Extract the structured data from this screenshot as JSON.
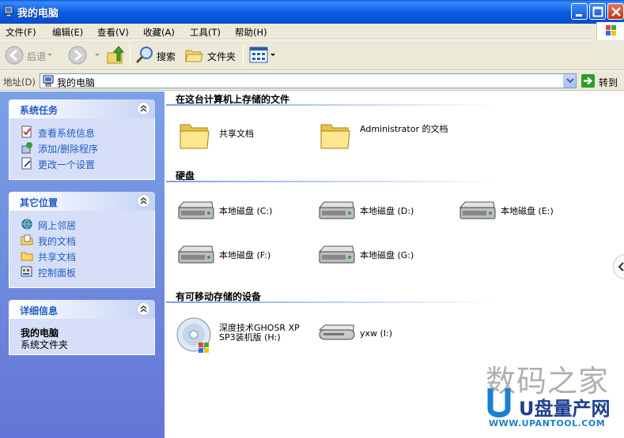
{
  "window": {
    "title": "我的电脑"
  },
  "menu": [
    "文件(F)",
    "编辑(E)",
    "查看(V)",
    "收藏(A)",
    "工具(T)",
    "帮助(H)"
  ],
  "toolbar": {
    "back": "后退",
    "search": "搜索",
    "folders": "文件夹"
  },
  "address": {
    "label": "地址(D)",
    "value": "我的电脑",
    "go": "转到"
  },
  "tasks": {
    "system": {
      "title": "系统任务",
      "items": [
        "查看系统信息",
        "添加/删除程序",
        "更改一个设置"
      ]
    },
    "places": {
      "title": "其它位置",
      "items": [
        "网上邻居",
        "我的文档",
        "共享文档",
        "控制面板"
      ]
    },
    "details": {
      "title": "详细信息",
      "name": "我的电脑",
      "desc": "系统文件夹"
    }
  },
  "sections": {
    "files": {
      "title": "在这台计算机上存储的文件",
      "items": [
        "共享文档",
        "Administrator 的文档"
      ]
    },
    "drives": {
      "title": "硬盘",
      "items": [
        "本地磁盘 (C:)",
        "本地磁盘 (D:)",
        "本地磁盘 (E:)",
        "本地磁盘 (F:)",
        "本地磁盘 (G:)"
      ]
    },
    "removable": {
      "title": "有可移动存储的设备",
      "items": [
        "深度技术GHOSR XP SP3装机版 (H:)",
        "yxw (I:)"
      ]
    }
  },
  "watermark": {
    "line1": "数码之家",
    "line2": "U盘量产网",
    "line3": "WWW.UPANTOOL.COM"
  },
  "colors": {
    "accent": "#215dc6",
    "titlebar": "#0b5ee5",
    "taskpane": "#6f8ee0"
  }
}
